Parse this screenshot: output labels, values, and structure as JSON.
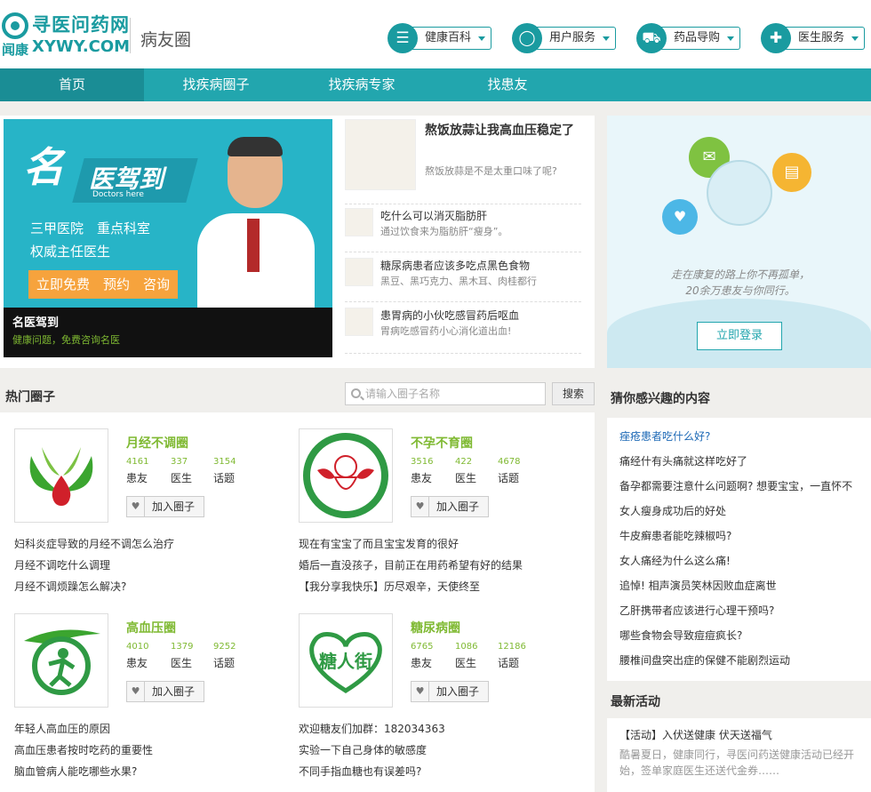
{
  "header": {
    "logo_cn": "寻医问药网",
    "logo_sub": "闻康",
    "logo_en": "XYWY.COM",
    "site_title": "病友圈",
    "services": [
      {
        "icon": "list-icon",
        "label": "健康百科"
      },
      {
        "icon": "user-icon",
        "label": "用户服务"
      },
      {
        "icon": "cart-icon",
        "label": "药品导购"
      },
      {
        "icon": "doctor-icon",
        "label": "医生服务"
      }
    ]
  },
  "nav": {
    "items": [
      "首页",
      "找疾病圈子",
      "找疾病专家",
      "找患友"
    ],
    "active": 0
  },
  "banner": {
    "big_char": "名",
    "ribbon_text": "医驾到",
    "ribbon_sub": "Doctors here",
    "line1": "三甲医院　重点科室",
    "line2": "权威主任医生",
    "cta": "立即免费　预约　咨询",
    "caption_title": "名医驾到",
    "caption_sub": "健康问题，免费咨询名医"
  },
  "news": [
    {
      "title": "熬饭放蒜让我高血压稳定了",
      "desc": "熬饭放蒜是不是太重口味了呢?"
    },
    {
      "title": "吃什么可以消灭脂肪肝",
      "desc": "通过饮食来为脂肪肝“瘦身”。"
    },
    {
      "title": "糖尿病患者应该多吃点黑色食物",
      "desc": "黑豆、黑巧克力、黑木耳、肉桂都行"
    },
    {
      "title": "患胃病的小伙吃感冒药后呕血",
      "desc": "胃病吃感冒药小心消化道出血!"
    }
  ],
  "login": {
    "slogan_line1": "走在康复的路上你不再孤单，",
    "slogan_line2": "20余万患友与你同行。",
    "button": "立即登录"
  },
  "hot": {
    "title": "热门圈子",
    "search_placeholder": "请输入圈子名称",
    "search_button": "搜索",
    "stat_labels": [
      "患友",
      "医生",
      "话题"
    ],
    "join_label": "加入圈子",
    "circles": [
      {
        "name": "月经不调圈",
        "stats": [
          "4161",
          "337",
          "3154"
        ],
        "posts": [
          "妇科炎症导致的月经不调怎么治疗",
          "月经不调吃什么调理",
          "月经不调烦躁怎么解决?"
        ]
      },
      {
        "name": "不孕不育圈",
        "stats": [
          "3516",
          "422",
          "4678"
        ],
        "posts": [
          "现在有宝宝了而且宝宝发育的很好",
          "婚后一直没孩子，目前正在用药希望有好的结果",
          "【我分享我快乐】历尽艰辛，天使终至"
        ]
      },
      {
        "name": "高血压圈",
        "stats": [
          "4010",
          "1379",
          "9252"
        ],
        "posts": [
          "年轻人高血压的原因",
          "高血压患者按时吃药的重要性",
          "脑血管病人能吃哪些水果?"
        ]
      },
      {
        "name": "糖尿病圈",
        "stats": [
          "6765",
          "1086",
          "12186"
        ],
        "logo_text": "糖人街",
        "posts": [
          "欢迎糖友们加群：182034363",
          "实验一下自己身体的敏感度",
          "不同手指血糖也有误差吗?"
        ]
      }
    ]
  },
  "interest": {
    "title": "猜你感兴趣的内容",
    "items": [
      "痤疮患者吃什么好?",
      "痛经什有头痛就这样吃好了",
      "备孕都需要注意什么问题啊? 想要宝宝，一直怀不",
      "女人瘦身成功后的好处",
      "牛皮癣患者能吃辣椒吗?",
      "女人痛经为什么这么痛!",
      "追悼! 相声演员笑林因败血症离世",
      "乙肝携带者应该进行心理干预吗?",
      "哪些食物会导致痘痘疯长?",
      "腰椎间盘突出症的保健不能剧烈运动"
    ]
  },
  "activity": {
    "title": "最新活动",
    "item_title": "【活动】入伏送健康 伏天送福气",
    "item_desc": "酷暑夏日，健康同行，寻医问药送健康活动已经开始，签单家庭医生还送代金券……"
  },
  "colors": {
    "accent": "#22a6ae",
    "green": "#7fb932",
    "link": "#1d69b6"
  }
}
